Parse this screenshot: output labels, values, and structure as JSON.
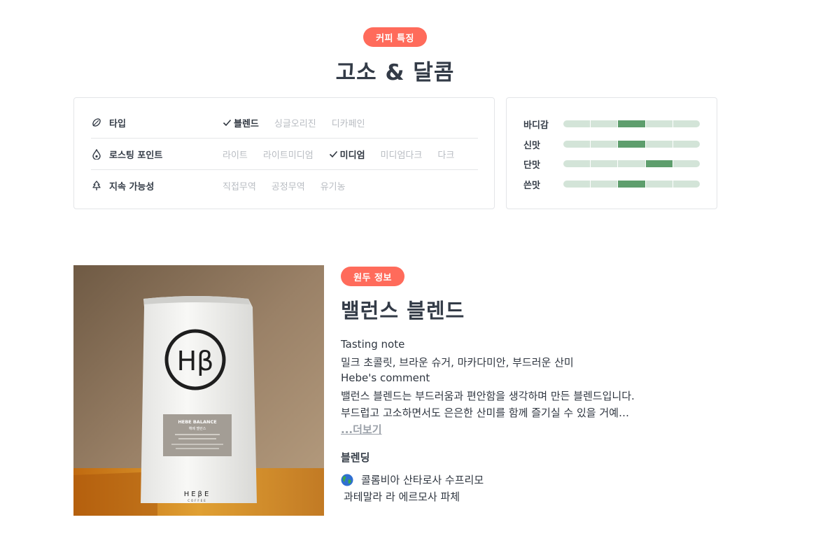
{
  "features": {
    "pill": "커피 특징",
    "title": "고소 & 달콤",
    "attributes": [
      {
        "icon": "leaf-icon",
        "label": "타입",
        "options": [
          {
            "label": "블렌드",
            "selected": true
          },
          {
            "label": "싱글오리진",
            "selected": false
          },
          {
            "label": "디카페인",
            "selected": false
          }
        ]
      },
      {
        "icon": "drop-icon",
        "label": "로스팅 포인트",
        "options": [
          {
            "label": "라이트",
            "selected": false
          },
          {
            "label": "라이트미디엄",
            "selected": false
          },
          {
            "label": "미디엄",
            "selected": true
          },
          {
            "label": "미디엄다크",
            "selected": false
          },
          {
            "label": "다크",
            "selected": false
          }
        ]
      },
      {
        "icon": "tree-icon",
        "label": "지속 가능성",
        "options": [
          {
            "label": "직접무역",
            "selected": false
          },
          {
            "label": "공정무역",
            "selected": false
          },
          {
            "label": "유기농",
            "selected": false
          }
        ]
      }
    ],
    "taste": [
      {
        "label": "바디감",
        "level": 3,
        "max": 5
      },
      {
        "label": "신맛",
        "level": 3,
        "max": 5
      },
      {
        "label": "단맛",
        "level": 4,
        "max": 5
      },
      {
        "label": "쓴맛",
        "level": 3,
        "max": 5
      }
    ],
    "colors": {
      "accent": "#ff6b5b",
      "bar_fill": "#5e9e6d",
      "bar_empty": "#d3e4d8"
    }
  },
  "bean": {
    "pill": "원두 정보",
    "name": "밸런스 블렌드",
    "tasting_note_label": "Tasting note",
    "tasting_note": "밀크 초콜릿, 브라운 슈거, 마카다미안, 부드러운 산미",
    "comment_label": "Hebe's comment",
    "comment_line1": "밸런스 블렌드는 부드러움과 편안함을 생각하며 만든 블렌드입니다.",
    "comment_line2": "부드럽고 고소하면서도 은은한 산미를 함께 즐기실 수 있을 거예…",
    "more_link": "...더보기",
    "blend_heading": "블렌딩",
    "origins": [
      "콜롬비아 산타로사 수프리모",
      "과테말라 라 에르모사 파체"
    ],
    "photo": {
      "logo": "Hβ",
      "label_title": "HEBE BALANCE",
      "label_sub": "헤베 밸런스",
      "brand": "HEβE",
      "brand_sub": "COFFEE"
    }
  }
}
